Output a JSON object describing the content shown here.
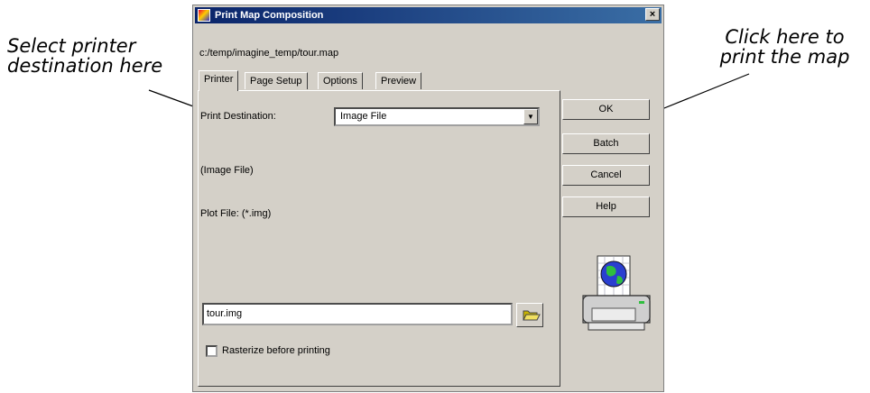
{
  "callouts": {
    "left_line1": "Select printer",
    "left_line2": "destination here",
    "right_line1": "Click here to",
    "right_line2": "print the map"
  },
  "dialog": {
    "title": "Print Map Composition",
    "close_label": "×",
    "file_path": "c:/temp/imagine_temp/tour.map",
    "tabs": [
      {
        "label": "Printer",
        "active": true
      },
      {
        "label": "Page Setup",
        "active": false
      },
      {
        "label": "Options",
        "active": false
      },
      {
        "label": "Preview",
        "active": false
      }
    ],
    "printer_tab": {
      "destination_label": "Print Destination:",
      "destination_value": "Image File",
      "type_label": "(Image File)",
      "plot_file_label": "Plot File: (*.img)",
      "plot_file_value": "tour.img",
      "rasterize_label": "Rasterize before printing",
      "rasterize_checked": false
    },
    "buttons": {
      "ok": "OK",
      "batch": "Batch",
      "cancel": "Cancel",
      "help": "Help"
    },
    "icons": {
      "app": "app-icon",
      "dropdown": "chevron-down-icon",
      "browse": "folder-icon",
      "printer": "printer-icon"
    }
  }
}
